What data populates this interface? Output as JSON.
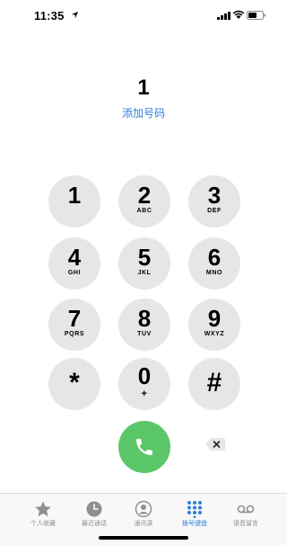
{
  "status_bar": {
    "time": "11:35"
  },
  "dialer": {
    "number": "1",
    "add_number": "添加号码"
  },
  "keys": [
    {
      "digit": "1",
      "letters": ""
    },
    {
      "digit": "2",
      "letters": "ABC"
    },
    {
      "digit": "3",
      "letters": "DEF"
    },
    {
      "digit": "4",
      "letters": "GHI"
    },
    {
      "digit": "5",
      "letters": "JKL"
    },
    {
      "digit": "6",
      "letters": "MNO"
    },
    {
      "digit": "7",
      "letters": "PQRS"
    },
    {
      "digit": "8",
      "letters": "TUV"
    },
    {
      "digit": "9",
      "letters": "WXYZ"
    },
    {
      "digit": "*",
      "letters": ""
    },
    {
      "digit": "0",
      "letters": "+"
    },
    {
      "digit": "#",
      "letters": ""
    }
  ],
  "tabs": [
    {
      "label": "个人收藏",
      "icon": "star-icon"
    },
    {
      "label": "最近通话",
      "icon": "clock-icon"
    },
    {
      "label": "通讯录",
      "icon": "contact-icon"
    },
    {
      "label": "拨号键盘",
      "icon": "keypad-icon",
      "active": true
    },
    {
      "label": "语音留言",
      "icon": "voicemail-icon"
    }
  ],
  "colors": {
    "accent": "#2f7ed8",
    "call_green": "#5cc768",
    "key_bg": "#e6e6e6"
  }
}
